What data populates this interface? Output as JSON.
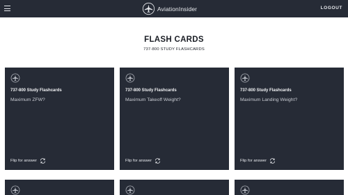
{
  "navbar": {
    "menu_icon": "hamburger-menu-icon",
    "brand_icon": "aviation-insider-logo-icon",
    "brand_name_part1": "Aviation",
    "brand_name_part2": "Insider",
    "logout_label": "LOGOUT"
  },
  "page": {
    "title": "FLASH CARDS",
    "subtitle": "737-800 STUDY FLASHCARDS"
  },
  "cards": [
    {
      "deck": "737-800 Study Flashcards",
      "question": "Maximum ZFW?",
      "flip_label": "Flip for answer",
      "flip_icon": "flip-arrows-icon"
    },
    {
      "deck": "737-800 Study Flashcards",
      "question": "Maximum Takeoff Weight?",
      "flip_label": "Flip for answer",
      "flip_icon": "flip-arrows-icon"
    },
    {
      "deck": "737-800 Study Flashcards",
      "question": "Maximum Landing Weight?",
      "flip_label": "Flip for answer",
      "flip_icon": "flip-arrows-icon"
    }
  ],
  "colors": {
    "navbar_bg": "#262b36",
    "card_bg": "#262b36",
    "page_bg": "#ffffff"
  }
}
